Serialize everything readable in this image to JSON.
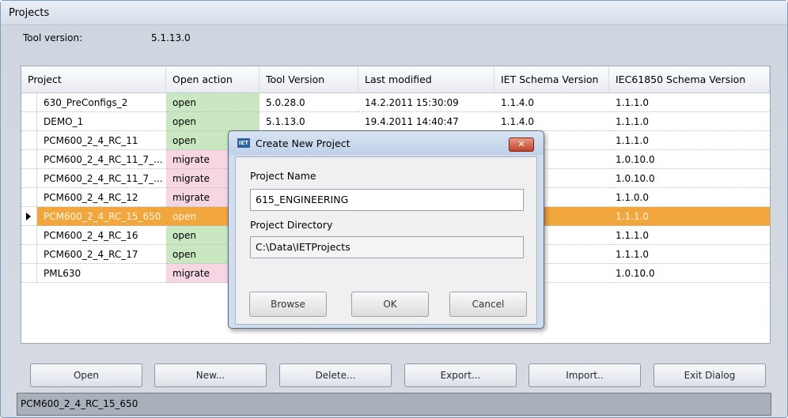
{
  "window": {
    "title": "Projects"
  },
  "tool": {
    "label": "Tool version:",
    "value": "5.1.13.0"
  },
  "table": {
    "headers": [
      "Project",
      "Open action",
      "Tool Version",
      "Last modified",
      "IET Schema Version",
      "IEC61850 Schema Version"
    ],
    "rows": [
      [
        "630_PreConfigs_2",
        "open",
        "5.0.28.0",
        "14.2.2011 15:30:09",
        "1.1.4.0",
        "1.1.1.0"
      ],
      [
        "DEMO_1",
        "open",
        "5.1.13.0",
        "19.4.2011 14:40:47",
        "1.1.4.0",
        "1.1.1.0"
      ],
      [
        "PCM600_2_4_RC_11",
        "open",
        "",
        "",
        "",
        "1.1.1.0"
      ],
      [
        "PCM600_2_4_RC_11_7_...",
        "migrate",
        "",
        "",
        "",
        "1.0.10.0"
      ],
      [
        "PCM600_2_4_RC_11_7_...",
        "migrate",
        "",
        "",
        "",
        "1.0.10.0"
      ],
      [
        "PCM600_2_4_RC_12",
        "migrate",
        "",
        "",
        "",
        "1.1.0.0"
      ],
      [
        "PCM600_2_4_RC_15_650",
        "open",
        "",
        "",
        "",
        "1.1.1.0"
      ],
      [
        "PCM600_2_4_RC_16",
        "open",
        "",
        "",
        "",
        "1.1.1.0"
      ],
      [
        "PCM600_2_4_RC_17",
        "open",
        "",
        "",
        "",
        "1.1.1.0"
      ],
      [
        "PML630",
        "migrate",
        "",
        "",
        "",
        "1.0.10.0"
      ]
    ],
    "selected_index": 6
  },
  "buttons": [
    "Open",
    "New...",
    "Delete...",
    "Export...",
    "Import..",
    "Exit Dialog"
  ],
  "status_text": "PCM600_2_4_RC_15_650",
  "dialog": {
    "icon_text": "IET",
    "title": "Create New Project",
    "project_name_label": "Project Name",
    "project_name_value": "615_ENGINEERING",
    "project_dir_label": "Project Directory",
    "project_dir_value": "C:\\Data\\IETProjects",
    "browse": "Browse",
    "ok": "OK",
    "cancel": "Cancel"
  },
  "colors": {
    "open": "#c9e7c1",
    "migrate": "#f6d6e3",
    "selected": "#f2a63e"
  }
}
